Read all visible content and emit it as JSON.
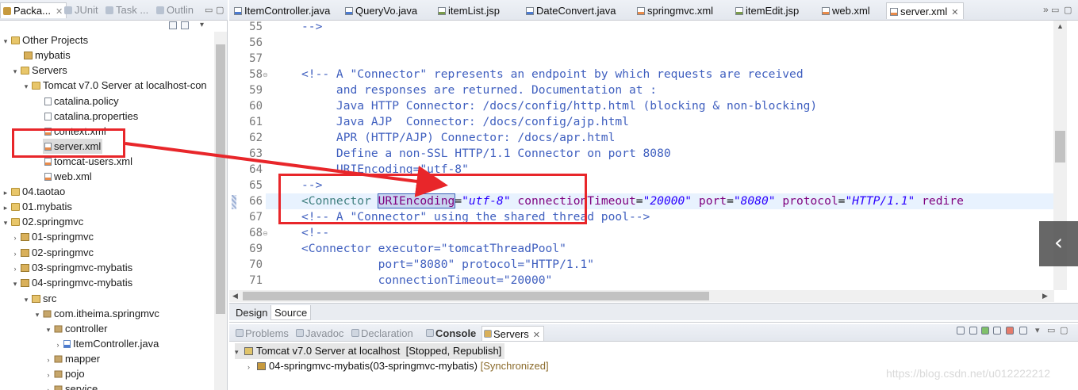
{
  "left_panel": {
    "tabs": [
      {
        "label": "Packa...",
        "close": "✕"
      },
      {
        "label": "JUnit"
      },
      {
        "label": "Task ..."
      },
      {
        "label": "Outlin"
      }
    ],
    "tree": [
      {
        "label": "Other Projects",
        "icon": "folder-icon"
      },
      {
        "label": "mybatis",
        "icon": "project-icon"
      },
      {
        "label": "Servers",
        "icon": "folder-icon"
      },
      {
        "label": "Tomcat v7.0 Server at localhost-con",
        "icon": "folder-icon"
      },
      {
        "label": "catalina.policy",
        "icon": "file-icon"
      },
      {
        "label": "catalina.properties",
        "icon": "file-icon"
      },
      {
        "label": "context.xml",
        "icon": "xml-file-icon"
      },
      {
        "label": "server.xml",
        "icon": "xml-file-icon"
      },
      {
        "label": "tomcat-users.xml",
        "icon": "xml-file-icon"
      },
      {
        "label": "web.xml",
        "icon": "xml-file-icon"
      },
      {
        "label": "04.taotao",
        "icon": "folder-icon"
      },
      {
        "label": "01.mybatis",
        "icon": "folder-icon"
      },
      {
        "label": "02.springmvc",
        "icon": "folder-icon"
      },
      {
        "label": "01-springmvc",
        "icon": "project-icon"
      },
      {
        "label": "02-springmvc",
        "icon": "project-icon"
      },
      {
        "label": "03-springmvc-mybatis",
        "icon": "project-icon"
      },
      {
        "label": "04-springmvc-mybatis",
        "icon": "project-icon"
      },
      {
        "label": "src",
        "icon": "source-folder-icon"
      },
      {
        "label": "com.itheima.springmvc",
        "icon": "package-icon"
      },
      {
        "label": "controller",
        "icon": "package-icon"
      },
      {
        "label": "ItemController.java",
        "icon": "java-file-icon"
      },
      {
        "label": "mapper",
        "icon": "package-icon"
      },
      {
        "label": "pojo",
        "icon": "package-icon"
      },
      {
        "label": "service",
        "icon": "package-icon"
      }
    ]
  },
  "editor": {
    "tabs": [
      {
        "label": "ItemController.java",
        "kind": "java"
      },
      {
        "label": "QueryVo.java",
        "kind": "java"
      },
      {
        "label": "itemList.jsp",
        "kind": "jsp"
      },
      {
        "label": "DateConvert.java",
        "kind": "java"
      },
      {
        "label": "springmvc.xml",
        "kind": "xml"
      },
      {
        "label": "itemEdit.jsp",
        "kind": "jsp"
      },
      {
        "label": "web.xml",
        "kind": "xml"
      },
      {
        "label": "server.xml",
        "kind": "xml",
        "close": "✕"
      }
    ],
    "tab_overflow": "»",
    "lines": [
      {
        "num": "55",
        "text": "-->"
      },
      {
        "num": "56",
        "text": ""
      },
      {
        "num": "57",
        "text": ""
      },
      {
        "num": "58",
        "text": "<!-- A \"Connector\" represents an endpoint by which requests are received"
      },
      {
        "num": "59",
        "text": "     and responses are returned. Documentation at :"
      },
      {
        "num": "60",
        "text": "     Java HTTP Connector: /docs/config/http.html (blocking & non-blocking)"
      },
      {
        "num": "61",
        "text": "     Java AJP  Connector: /docs/config/ajp.html"
      },
      {
        "num": "62",
        "text": "     APR (HTTP/AJP) Connector: /docs/apr.html"
      },
      {
        "num": "63",
        "text": "     Define a non-SSL HTTP/1.1 Connector on port 8080"
      },
      {
        "num": "64",
        "text": "     URIEncoding=\"utf-8\""
      },
      {
        "num": "65",
        "text": "-->"
      },
      {
        "num": "66",
        "text": ""
      },
      {
        "num": "67",
        "text": "<!-- A \"Connector\" using the shared thread pool-->"
      },
      {
        "num": "68",
        "text": "<!--"
      },
      {
        "num": "69",
        "text": "<Connector executor=\"tomcatThreadPool\""
      },
      {
        "num": "70",
        "text": "           port=\"8080\" protocol=\"HTTP/1.1\""
      },
      {
        "num": "71",
        "text": "           connectionTimeout=\"20000\""
      }
    ],
    "line66": {
      "open": "<Connector ",
      "attr1": "URIEncoding",
      "val1": "\"utf-8\"",
      "attr2": "connectionTimeout",
      "val2": "\"20000\"",
      "attr3": "port",
      "val3": "\"8080\"",
      "attr4": "protocol",
      "val4": "\"HTTP/1.1\"",
      "attr5": "redire"
    },
    "bottom_tabs": {
      "design": "Design",
      "source": "Source"
    }
  },
  "bottom_panel": {
    "tabs": [
      {
        "label": "Problems"
      },
      {
        "label": "Javadoc"
      },
      {
        "label": "Declaration"
      },
      {
        "label": "Console"
      },
      {
        "label": "Servers",
        "close": "✕"
      }
    ],
    "server": {
      "name": "Tomcat v7.0 Server at localhost",
      "state": "[Stopped, Republish]"
    },
    "module": {
      "name": "04-springmvc-mybatis(03-springmvc-mybatis)",
      "state": "[Synchronized]"
    }
  },
  "overlay": {
    "nav_button": "‹"
  },
  "watermark": "https://blog.csdn.net/u012222212"
}
